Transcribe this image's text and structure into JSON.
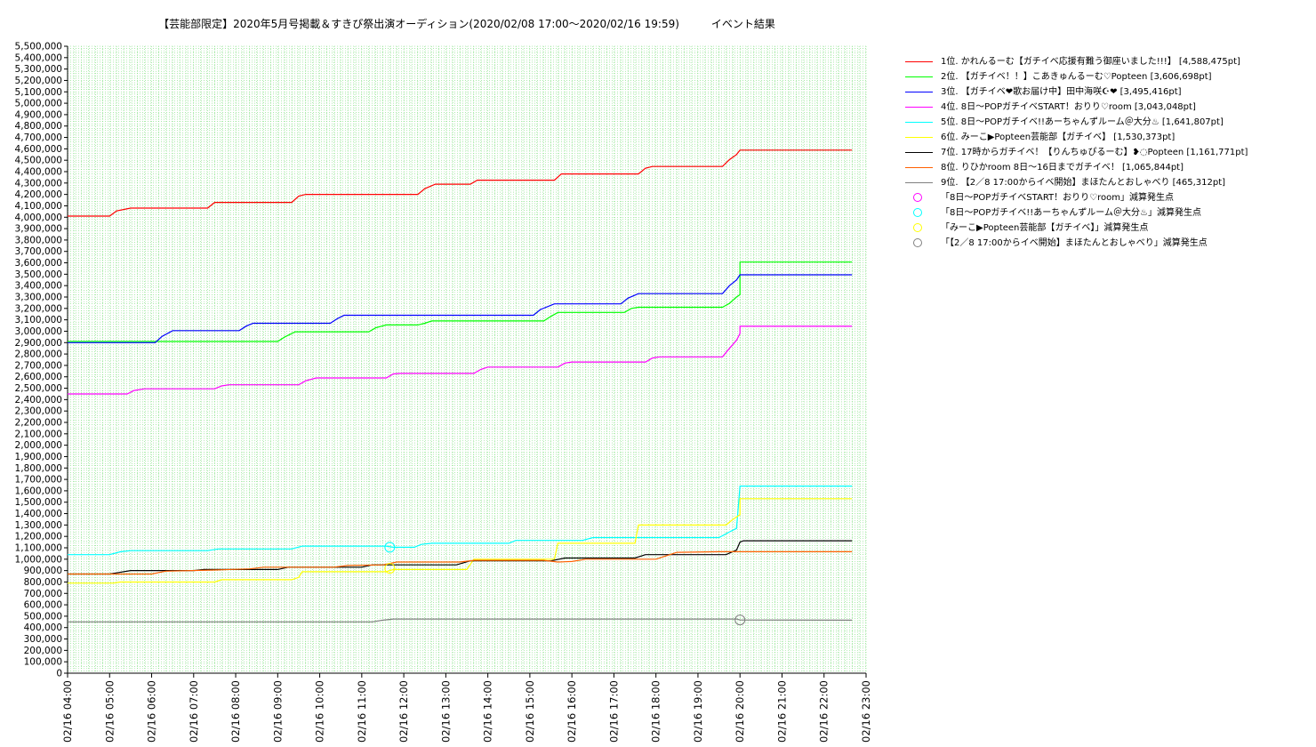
{
  "chart_data": {
    "type": "line",
    "title": "【芸能部限定】2020年5月号掲載＆すきぴ祭出演オーディション(2020/02/08 17:00～2020/02/16 19:59)　　　イベント結果",
    "xlabel": "",
    "ylabel": "",
    "x_range": [
      "02/16 04:00",
      "02/16 23:00"
    ],
    "ylim": [
      0,
      5500000
    ],
    "y_tick_step": 100000,
    "x_tick_labels": [
      "02/16 04:00",
      "02/16 05:00",
      "02/16 06:00",
      "02/16 07:00",
      "02/16 08:00",
      "02/16 09:00",
      "02/16 10:00",
      "02/16 11:00",
      "02/16 12:00",
      "02/16 13:00",
      "02/16 14:00",
      "02/16 15:00",
      "02/16 16:00",
      "02/16 17:00",
      "02/16 18:00",
      "02/16 19:00",
      "02/16 20:00",
      "02/16 21:00",
      "02/16 22:00",
      "02/16 23:00"
    ],
    "grid": true,
    "legend_position": "right",
    "series": [
      {
        "name": "1位. かれんるーむ【ガチイベ応援有難う御座いました!!!】 [4,588,475pt]",
        "color": "#ff0000",
        "points": [
          [
            "04:00",
            4010000
          ],
          [
            "05:00",
            4010000
          ],
          [
            "05:10",
            4055000
          ],
          [
            "05:30",
            4080000
          ],
          [
            "07:20",
            4080000
          ],
          [
            "07:30",
            4130000
          ],
          [
            "09:20",
            4130000
          ],
          [
            "09:30",
            4185000
          ],
          [
            "09:40",
            4200000
          ],
          [
            "12:20",
            4200000
          ],
          [
            "12:30",
            4250000
          ],
          [
            "12:45",
            4290000
          ],
          [
            "13:35",
            4290000
          ],
          [
            "13:45",
            4325000
          ],
          [
            "15:35",
            4325000
          ],
          [
            "15:45",
            4380000
          ],
          [
            "17:35",
            4380000
          ],
          [
            "17:45",
            4430000
          ],
          [
            "17:55",
            4445000
          ],
          [
            "19:35",
            4445000
          ],
          [
            "19:45",
            4505000
          ],
          [
            "19:55",
            4550000
          ],
          [
            "20:00",
            4588475
          ],
          [
            "22:40",
            4588475
          ]
        ]
      },
      {
        "name": "2位. 【ガチイベ！！】こあきゅんるーむ♡Popteen [3,606,698pt]",
        "color": "#00ff00",
        "points": [
          [
            "04:00",
            2910000
          ],
          [
            "09:00",
            2910000
          ],
          [
            "09:10",
            2950000
          ],
          [
            "09:25",
            2995000
          ],
          [
            "11:10",
            2995000
          ],
          [
            "11:20",
            3030000
          ],
          [
            "11:35",
            3055000
          ],
          [
            "12:20",
            3055000
          ],
          [
            "12:30",
            3070000
          ],
          [
            "12:40",
            3090000
          ],
          [
            "15:20",
            3090000
          ],
          [
            "15:30",
            3130000
          ],
          [
            "15:40",
            3165000
          ],
          [
            "17:15",
            3165000
          ],
          [
            "17:25",
            3200000
          ],
          [
            "17:35",
            3210000
          ],
          [
            "19:35",
            3210000
          ],
          [
            "19:45",
            3245000
          ],
          [
            "19:55",
            3300000
          ],
          [
            "20:00",
            3320000
          ],
          [
            "20:00",
            3606698
          ],
          [
            "22:40",
            3606698
          ]
        ]
      },
      {
        "name": "3位. 【ガチイベ❤歌お届け中】田中海咲☪❤ [3,495,416pt]",
        "color": "#0000ff",
        "points": [
          [
            "04:00",
            2900000
          ],
          [
            "06:05",
            2900000
          ],
          [
            "06:15",
            2955000
          ],
          [
            "06:30",
            3005000
          ],
          [
            "08:05",
            3005000
          ],
          [
            "08:15",
            3045000
          ],
          [
            "08:25",
            3070000
          ],
          [
            "10:15",
            3070000
          ],
          [
            "10:25",
            3110000
          ],
          [
            "10:35",
            3140000
          ],
          [
            "15:05",
            3140000
          ],
          [
            "15:15",
            3190000
          ],
          [
            "15:35",
            3240000
          ],
          [
            "17:10",
            3240000
          ],
          [
            "17:20",
            3290000
          ],
          [
            "17:35",
            3330000
          ],
          [
            "19:35",
            3330000
          ],
          [
            "19:45",
            3400000
          ],
          [
            "19:55",
            3450000
          ],
          [
            "20:00",
            3495416
          ],
          [
            "22:40",
            3495416
          ]
        ]
      },
      {
        "name": "4位. 8日～POPガチイベSTART！おりり♡room [3,043,048pt]",
        "color": "#ff00ff",
        "points": [
          [
            "04:00",
            2450000
          ],
          [
            "05:25",
            2450000
          ],
          [
            "05:35",
            2480000
          ],
          [
            "05:50",
            2495000
          ],
          [
            "07:30",
            2495000
          ],
          [
            "07:40",
            2520000
          ],
          [
            "07:50",
            2530000
          ],
          [
            "09:30",
            2530000
          ],
          [
            "09:40",
            2565000
          ],
          [
            "09:55",
            2590000
          ],
          [
            "11:35",
            2590000
          ],
          [
            "11:45",
            2625000
          ],
          [
            "11:55",
            2630000
          ],
          [
            "13:40",
            2630000
          ],
          [
            "13:50",
            2665000
          ],
          [
            "14:00",
            2685000
          ],
          [
            "15:40",
            2685000
          ],
          [
            "15:50",
            2720000
          ],
          [
            "16:00",
            2730000
          ],
          [
            "17:45",
            2730000
          ],
          [
            "17:55",
            2765000
          ],
          [
            "18:05",
            2775000
          ],
          [
            "19:35",
            2775000
          ],
          [
            "19:45",
            2850000
          ],
          [
            "19:55",
            2920000
          ],
          [
            "20:00",
            2980000
          ],
          [
            "20:00",
            3043048
          ],
          [
            "22:40",
            3043048
          ]
        ]
      },
      {
        "name": "5位. 8日～POPガチイベ!!あーちゃんずルーム＠大分♨ [1,641,807pt]",
        "color": "#00ffff",
        "points": [
          [
            "04:00",
            1040000
          ],
          [
            "05:00",
            1040000
          ],
          [
            "05:15",
            1065000
          ],
          [
            "05:30",
            1075000
          ],
          [
            "07:20",
            1075000
          ],
          [
            "07:35",
            1090000
          ],
          [
            "09:20",
            1090000
          ],
          [
            "09:35",
            1115000
          ],
          [
            "11:35",
            1115000
          ],
          [
            "11:45",
            1105000
          ],
          [
            "12:15",
            1105000
          ],
          [
            "12:25",
            1130000
          ],
          [
            "12:40",
            1140000
          ],
          [
            "14:30",
            1140000
          ],
          [
            "14:40",
            1165000
          ],
          [
            "16:15",
            1165000
          ],
          [
            "16:30",
            1190000
          ],
          [
            "19:30",
            1190000
          ],
          [
            "19:45",
            1240000
          ],
          [
            "19:55",
            1270000
          ],
          [
            "20:00",
            1641807
          ],
          [
            "22:40",
            1641807
          ]
        ]
      },
      {
        "name": "6位. みーこ▶Popteen芸能部【ガチイベ】 [1,530,373pt]",
        "color": "#ffff00",
        "points": [
          [
            "04:00",
            790000
          ],
          [
            "05:05",
            790000
          ],
          [
            "05:15",
            800000
          ],
          [
            "07:30",
            800000
          ],
          [
            "07:40",
            820000
          ],
          [
            "09:20",
            820000
          ],
          [
            "09:30",
            840000
          ],
          [
            "09:35",
            890000
          ],
          [
            "11:35",
            890000
          ],
          [
            "11:45",
            910000
          ],
          [
            "13:30",
            910000
          ],
          [
            "13:40",
            1000000
          ],
          [
            "15:35",
            1000000
          ],
          [
            "15:40",
            1140000
          ],
          [
            "17:30",
            1140000
          ],
          [
            "17:35",
            1300000
          ],
          [
            "19:40",
            1300000
          ],
          [
            "19:50",
            1350000
          ],
          [
            "20:00",
            1390000
          ],
          [
            "20:00",
            1530373
          ],
          [
            "22:40",
            1530373
          ]
        ]
      },
      {
        "name": "7位. 17時からガチイベ！【りんちゅぴるーむ】❥◌Popteen [1,161,771pt]",
        "color": "#000000",
        "points": [
          [
            "04:00",
            870000
          ],
          [
            "05:00",
            870000
          ],
          [
            "05:10",
            880000
          ],
          [
            "05:30",
            900000
          ],
          [
            "07:00",
            900000
          ],
          [
            "07:15",
            910000
          ],
          [
            "09:00",
            910000
          ],
          [
            "09:15",
            930000
          ],
          [
            "11:00",
            930000
          ],
          [
            "11:15",
            950000
          ],
          [
            "13:15",
            950000
          ],
          [
            "13:35",
            985000
          ],
          [
            "15:30",
            985000
          ],
          [
            "15:50",
            1010000
          ],
          [
            "17:30",
            1010000
          ],
          [
            "17:45",
            1040000
          ],
          [
            "19:40",
            1040000
          ],
          [
            "19:55",
            1080000
          ],
          [
            "20:00",
            1150000
          ],
          [
            "20:05",
            1161771
          ],
          [
            "22:40",
            1161771
          ]
        ]
      },
      {
        "name": "8位. りひかroom 8日～16日までガチイベ！ [1,065,844pt]",
        "color": "#ff6000",
        "points": [
          [
            "04:00",
            870000
          ],
          [
            "05:00",
            870000
          ],
          [
            "06:00",
            870000
          ],
          [
            "06:20",
            895000
          ],
          [
            "07:30",
            905000
          ],
          [
            "08:20",
            915000
          ],
          [
            "08:40",
            930000
          ],
          [
            "10:20",
            930000
          ],
          [
            "10:40",
            945000
          ],
          [
            "11:30",
            950000
          ],
          [
            "11:50",
            975000
          ],
          [
            "13:20",
            975000
          ],
          [
            "13:40",
            990000
          ],
          [
            "15:20",
            990000
          ],
          [
            "15:40",
            975000
          ],
          [
            "16:00",
            980000
          ],
          [
            "16:20",
            1000000
          ],
          [
            "18:00",
            1000000
          ],
          [
            "18:20",
            1040000
          ],
          [
            "18:30",
            1060000
          ],
          [
            "19:30",
            1065844
          ],
          [
            "22:40",
            1065844
          ]
        ]
      },
      {
        "name": "9位. 【2／8 17:00からイベ開始】まほたんとおしゃべり [465,312pt]",
        "color": "#808080",
        "points": [
          [
            "04:00",
            450000
          ],
          [
            "11:15",
            450000
          ],
          [
            "11:30",
            465000
          ],
          [
            "11:45",
            475000
          ],
          [
            "19:55",
            475000
          ],
          [
            "20:00",
            467000
          ],
          [
            "22:40",
            465312
          ]
        ]
      }
    ],
    "markers": [
      {
        "name": "「8日～POPガチイベSTART！おりり♡room」減算発生点",
        "color": "#ff00ff",
        "points": []
      },
      {
        "name": "「8日～POPガチイベ!!あーちゃんずルーム＠大分♨」減算発生点",
        "color": "#00ffff",
        "points": [
          [
            "11:40",
            1105000
          ]
        ]
      },
      {
        "name": "「みーこ▶Popteen芸能部【ガチイベ】」減算発生点",
        "color": "#ffff00",
        "points": [
          [
            "11:40",
            920000
          ]
        ]
      },
      {
        "name": "「【2／8 17:00からイベ開始】まほたんとおしゃべり」減算発生点",
        "color": "#808080",
        "points": [
          [
            "20:00",
            467000
          ]
        ]
      }
    ]
  }
}
